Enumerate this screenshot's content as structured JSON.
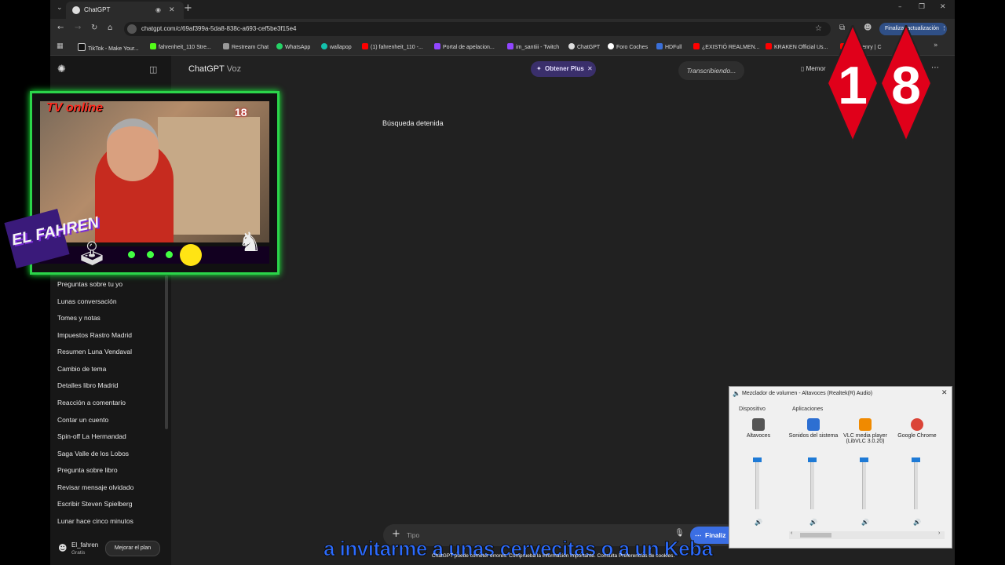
{
  "browser": {
    "tab_title": "ChatGPT",
    "url": "chatgpt.com/c/69af399a-5da8-838c-a693-cef5be3f15e4",
    "update_button": "Finalizar actualización",
    "bookmarks": [
      "TikTok - Make Your...",
      "fahrenheit_110 Stre...",
      "Restream Chat",
      "WhatsApp",
      "wallapop",
      "(1) fahrenheit_110 -...",
      "Portal de apelacion...",
      "im_santiii - Twitch",
      "ChatGPT",
      "Foro Coches",
      "HDFull",
      "¿EXISTIÓ REALMEN...",
      "KRAKEN Official Us...",
      "ore Henry | C"
    ]
  },
  "header": {
    "title": "ChatGPT",
    "title_suffix": "Voz",
    "plus_button": "Obtener Plus",
    "status_pill": "Transcribiendo...",
    "memory_label": "Memor"
  },
  "main": {
    "stopped_search": "Búsqueda detenida",
    "input_placeholder": "Tipo",
    "finish_button": "Finaliz",
    "disclaimer": "ChatGPT puede cometer errores. Comprueba la información importante. Consulta Preferencias de cookies."
  },
  "sidebar": {
    "items": [
      "Preguntas sobre tu yo",
      "Lunas conversación",
      "Tomes y notas",
      "Impuestos Rastro Madrid",
      "Resumen Luna Vendaval",
      "Cambio de tema",
      "Detalles libro Madrid",
      "Reacción a comentario",
      "Contar un cuento",
      "Spin-off La Hermandad",
      "Saga Valle de los Lobos",
      "Pregunta sobre libro",
      "Revisar mensaje olvidado",
      "Escribir Steven Spielberg",
      "Lunar hace cinco minutos"
    ],
    "user_name": "El_fahren",
    "user_plan": "Gratis",
    "upgrade_button": "Mejorar el plan"
  },
  "overlay": {
    "tv_label": "TV online",
    "age_rating": "18",
    "logo_text": "EL FAHREN",
    "big_digits": [
      "1",
      "8"
    ],
    "subtitle": "a invitarme a unas cervecitas o a un Keba"
  },
  "mixer": {
    "title": "Mezclador de volumen - Altavoces (Realtek(R) Audio)",
    "device_label": "Dispositivo",
    "apps_label": "Aplicaciones",
    "channels": [
      {
        "name": "Altavoces",
        "level": 100
      },
      {
        "name": "Sonidos del sistema",
        "level": 100
      },
      {
        "name": "VLC media player (LibVLC 3.0.20)",
        "level": 100
      },
      {
        "name": "Google Chrome",
        "level": 100
      }
    ]
  },
  "colors": {
    "accent_green": "#2bd44a",
    "plus_pill": "#3a2f6b",
    "diamond_red": "#e0001a"
  }
}
